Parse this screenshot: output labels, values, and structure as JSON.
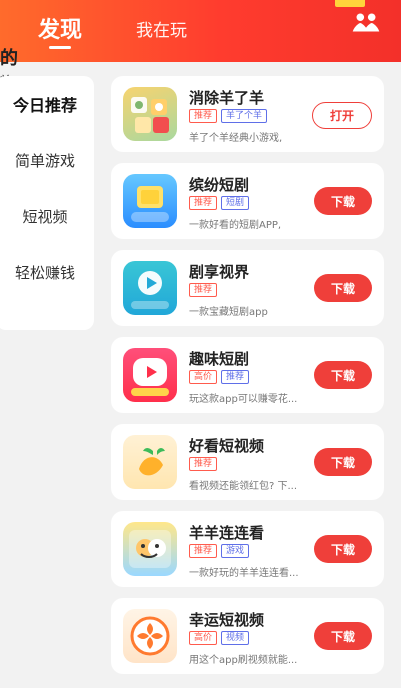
{
  "header": {
    "tabs": [
      {
        "label": "发现",
        "active": true
      },
      {
        "label": "我在玩",
        "active": false
      }
    ],
    "top_right_icon": "people-icon"
  },
  "left_clip": {
    "glyph1": "的",
    "glyph2": "前"
  },
  "sidebar": {
    "items": [
      {
        "label": "今日推荐",
        "active": true
      },
      {
        "label": "简单游戏",
        "active": false
      },
      {
        "label": "短视频",
        "active": false
      },
      {
        "label": "轻松赚钱",
        "active": false
      }
    ]
  },
  "apps": [
    {
      "title": "消除羊了羊",
      "tags": [
        {
          "text": "推荐",
          "style": "red"
        },
        {
          "text": "羊了个羊",
          "style": "blue"
        }
      ],
      "desc": "羊了个羊经典小游戏,",
      "button": "打开",
      "button_style": "outline",
      "icon": "sheep-game-icon"
    },
    {
      "title": "缤纷短剧",
      "tags": [
        {
          "text": "推荐",
          "style": "red"
        },
        {
          "text": "短剧",
          "style": "blue"
        }
      ],
      "desc": "一款好看的短剧APP,",
      "button": "下载",
      "button_style": "primary",
      "icon": "short-drama-icon"
    },
    {
      "title": "剧享视界",
      "tags": [
        {
          "text": "推荐",
          "style": "red"
        }
      ],
      "desc": "一款宝藏短剧app",
      "button": "下载",
      "button_style": "primary",
      "icon": "video-play-icon"
    },
    {
      "title": "趣味短剧",
      "tags": [
        {
          "text": "高价",
          "style": "red"
        },
        {
          "text": "推荐",
          "style": "blue"
        }
      ],
      "desc": "玩这款app可以赚零花...",
      "button": "下载",
      "button_style": "primary",
      "icon": "fun-drama-icon"
    },
    {
      "title": "好看短视频",
      "tags": [
        {
          "text": "推荐",
          "style": "red"
        }
      ],
      "desc": "看视频还能领红包? 下...",
      "button": "下载",
      "button_style": "primary",
      "icon": "carrot-icon"
    },
    {
      "title": "羊羊连连看",
      "tags": [
        {
          "text": "推荐",
          "style": "red"
        },
        {
          "text": "游戏",
          "style": "blue"
        }
      ],
      "desc": "一款好玩的羊羊连连看...",
      "button": "下载",
      "button_style": "primary",
      "icon": "match-game-icon"
    },
    {
      "title": "幸运短视频",
      "tags": [
        {
          "text": "高价",
          "style": "red"
        },
        {
          "text": "视频",
          "style": "blue"
        }
      ],
      "desc": "用这个app刷视频就能...",
      "button": "下载",
      "button_style": "primary",
      "icon": "lucky-clover-icon"
    }
  ]
}
